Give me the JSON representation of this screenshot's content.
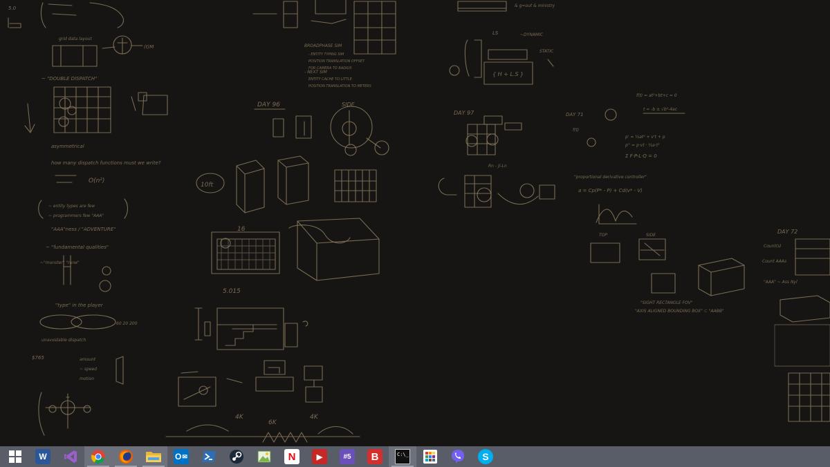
{
  "taskbar": {
    "items": [
      {
        "name": "start-button",
        "icon": "windows-logo-icon",
        "glyph": "",
        "bg": "",
        "running": false,
        "active": false
      },
      {
        "name": "taskbar-word",
        "icon": "word-icon",
        "glyph": "W",
        "bg": "#2b579a",
        "running": false,
        "active": false
      },
      {
        "name": "taskbar-visual-studio",
        "icon": "visual-studio-icon",
        "glyph": "",
        "bg": "#68217a",
        "running": false,
        "active": false
      },
      {
        "name": "taskbar-chrome",
        "icon": "chrome-icon",
        "glyph": "",
        "bg": "",
        "running": true,
        "active": true
      },
      {
        "name": "taskbar-firefox",
        "icon": "firefox-icon",
        "glyph": "",
        "bg": "",
        "running": true,
        "active": true
      },
      {
        "name": "taskbar-file-explorer",
        "icon": "folder-icon",
        "glyph": "",
        "bg": "#e8b83a",
        "running": true,
        "active": true
      },
      {
        "name": "taskbar-outlook",
        "icon": "outlook-icon",
        "glyph": "O",
        "bg": "#0072c6",
        "running": false,
        "active": false
      },
      {
        "name": "taskbar-powershell",
        "icon": "powershell-icon",
        "glyph": "",
        "bg": "#2c6fb7",
        "running": false,
        "active": false
      },
      {
        "name": "taskbar-steam",
        "icon": "steam-icon",
        "glyph": "",
        "bg": "#1b2838",
        "running": false,
        "active": false
      },
      {
        "name": "taskbar-image-viewer",
        "icon": "landscape-image-icon",
        "glyph": "",
        "bg": "#7fb34d",
        "running": false,
        "active": false
      },
      {
        "name": "taskbar-netflix",
        "icon": "netflix-icon",
        "glyph": "N",
        "bg": "#ffffff",
        "running": false,
        "active": false
      },
      {
        "name": "taskbar-video-player",
        "icon": "play-icon",
        "glyph": "▶",
        "bg": "#c62828",
        "running": false,
        "active": false
      },
      {
        "name": "taskbar-hashtag-app",
        "icon": "hashtag-app-icon",
        "glyph": "#5",
        "bg": "#6b4fbb",
        "running": false,
        "active": false
      },
      {
        "name": "taskbar-b-app",
        "icon": "b-app-icon",
        "glyph": "B",
        "bg": "#d32f2f",
        "running": false,
        "active": false
      },
      {
        "name": "taskbar-command-prompt",
        "icon": "terminal-icon",
        "glyph": "C:\\_",
        "bg": "#101010",
        "running": true,
        "active": true
      },
      {
        "name": "taskbar-store-apps",
        "icon": "apps-grid-icon",
        "glyph": "",
        "bg": "#ffffff",
        "running": false,
        "active": false
      },
      {
        "name": "taskbar-viber",
        "icon": "viber-icon",
        "glyph": "",
        "bg": "#7360f2",
        "running": false,
        "active": false
      },
      {
        "name": "taskbar-skype",
        "icon": "skype-icon",
        "glyph": "S",
        "bg": "#00aff0",
        "running": false,
        "active": false
      }
    ]
  }
}
